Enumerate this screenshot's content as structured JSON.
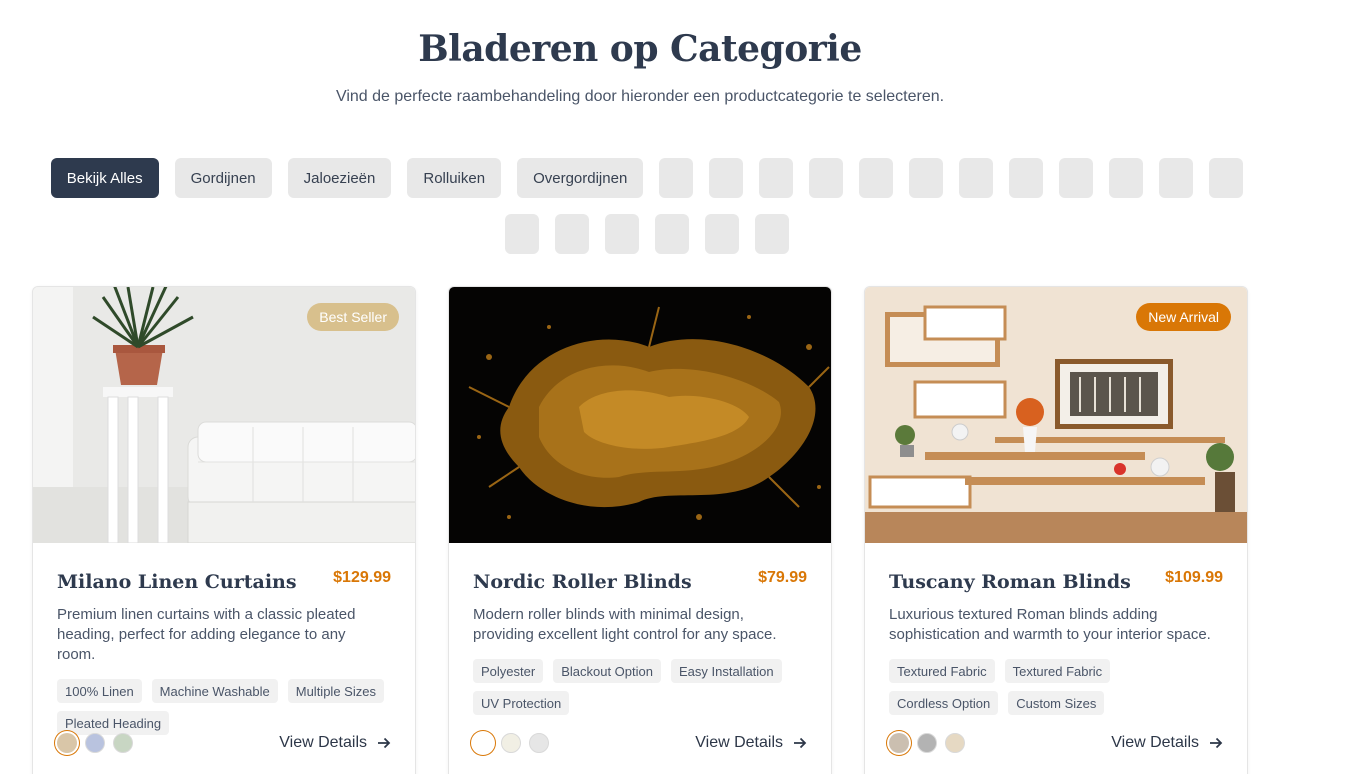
{
  "header": {
    "title": "Bladeren op Categorie",
    "subtitle": "Vind de perfecte raambehandeling door hieronder een productcategorie te selecteren."
  },
  "filters": {
    "labels": [
      "Bekijk Alles",
      "Gordijnen",
      "Jaloezieën",
      "Rolluiken",
      "Overgordijnen"
    ],
    "active_index": 0,
    "empty_count": 18
  },
  "colors": {
    "accent": "#d97706",
    "dark": "#2e3a4e",
    "best_seller_badge": "#d8c08d",
    "new_arrival_badge": "#d97706"
  },
  "products": [
    {
      "badge": "Best Seller",
      "name": "Milano Linen Curtains",
      "price": "$129.99",
      "description": "Premium linen curtains with a classic pleated heading, perfect for adding elegance to any room.",
      "tags": [
        "100% Linen",
        "Machine Washable",
        "Multiple Sizes",
        "Pleated Heading"
      ],
      "swatches": [
        "#d9c6a8",
        "#b9c3df",
        "#c8d6c3"
      ],
      "cta": "View Details"
    },
    {
      "badge": "",
      "name": "Nordic Roller Blinds",
      "price": "$79.99",
      "description": "Modern roller blinds with minimal design, providing excellent light control for any space.",
      "tags": [
        "Polyester",
        "Blackout Option",
        "Easy Installation",
        "UV Protection"
      ],
      "swatches": [
        "#ffffff",
        "#f1efe4",
        "#e6e6e6"
      ],
      "cta": "View Details"
    },
    {
      "badge": "New Arrival",
      "name": "Tuscany Roman Blinds",
      "price": "$109.99",
      "description": "Luxurious textured Roman blinds adding sophistication and warmth to your interior space.",
      "tags": [
        "Textured Fabric",
        "Textured Fabric",
        "Cordless Option",
        "Custom Sizes"
      ],
      "swatches": [
        "#cbbfb0",
        "#b3b3b3",
        "#e6d9c3"
      ],
      "cta": "View Details"
    }
  ]
}
